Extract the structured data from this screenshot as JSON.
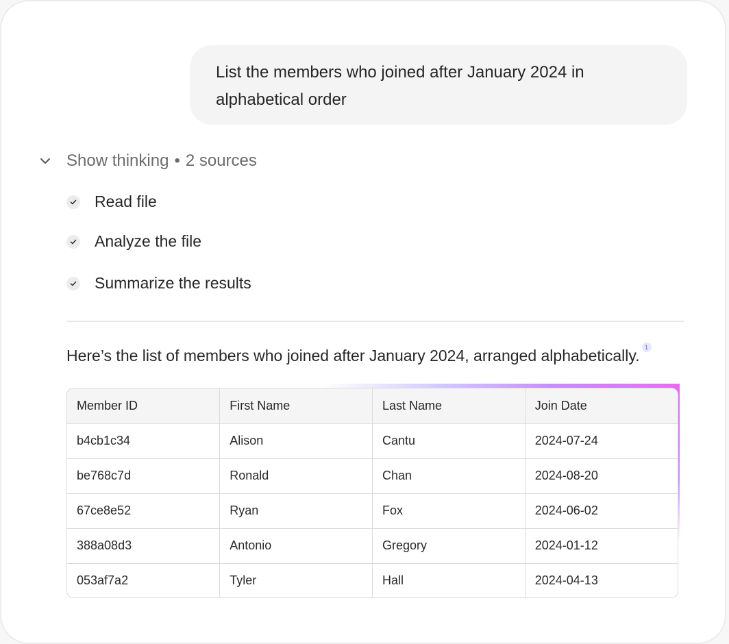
{
  "user_message": {
    "line1": "List the members who joined after January 2024 in",
    "line2": "alphabetical order"
  },
  "thinking": {
    "label": "Show thinking",
    "separator": "•",
    "sources": "2 sources",
    "steps": [
      "Read file",
      "Analyze the file",
      "Summarize the results"
    ]
  },
  "answer": {
    "text": "Here’s the list of members who joined after January 2024, arranged alphabetically.",
    "citation": "1"
  },
  "table": {
    "headers": [
      "Member ID",
      "First Name",
      "Last Name",
      "Join Date"
    ],
    "rows": [
      [
        "b4cb1c34",
        "Alison",
        "Cantu",
        "2024-07-24"
      ],
      [
        "be768c7d",
        "Ronald",
        "Chan",
        "2024-08-20"
      ],
      [
        "67ce8e52",
        "Ryan",
        "Fox",
        "2024-06-02"
      ],
      [
        "388a08d3",
        "Antonio",
        "Gregory",
        "2024-01-12"
      ],
      [
        "053af7a2",
        "Tyler",
        "Hall",
        "2024-04-13"
      ]
    ]
  },
  "icons": {
    "toggle": "chevron-down-icon",
    "step": "checkmark-icon"
  },
  "colors": {
    "glow_start": "#cfc6ff",
    "glow_end": "#e96bf2",
    "citation_bg": "#e6e8ff"
  }
}
